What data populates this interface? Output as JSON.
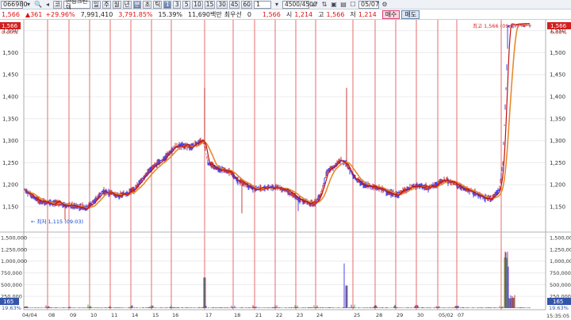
{
  "toolbar": {
    "code": "066980",
    "type_btn": "코",
    "name": "한성크린텍",
    "periods": [
      "일",
      "주",
      "월",
      "년",
      "분",
      "초",
      "틱"
    ],
    "selected_period": "분",
    "numbers": [
      "1",
      "3",
      "5",
      "10",
      "15",
      "30",
      "45",
      "60"
    ],
    "count": "1",
    "range": "4500/4500",
    "date": "05/07"
  },
  "quote": {
    "price": "1,566",
    "change": "361",
    "change_pct": "+29.96%",
    "volume": "7,991,410",
    "volume_pct": "3,791.85%",
    "turnover": "15.39%",
    "amount": "11,690백만",
    "preferred_label": "최우선",
    "preferred_value": "0",
    "price2": "1,566",
    "open_label": "시",
    "open": "1,214",
    "high_label": "고",
    "high": "1,566",
    "low_label": "저",
    "low": "1,214",
    "buy_label": "매수",
    "sell_label": "매도"
  },
  "chart_data": {
    "type": "line",
    "price_axis": [
      "1,566",
      "1,550",
      "1,500",
      "1,450",
      "1,400",
      "1,350",
      "1,300",
      "1,250",
      "1,200",
      "1,150"
    ],
    "volume_axis": [
      "1,500,000",
      "1,250,000",
      "1,000,000",
      "750,000",
      "500,000",
      "250,000"
    ],
    "dates": [
      "04/04",
      "08",
      "09",
      "10",
      "11",
      "14",
      "15",
      "16",
      "17",
      "18",
      "21",
      "22",
      "23",
      "24",
      "25",
      "28",
      "29",
      "30",
      "05/02",
      "07"
    ],
    "high_annotation": "최고 1,566 (09:27)",
    "low_annotation": "최저 1,115 (09:03)",
    "price_label_left": "1,566",
    "price_label_left_pct": "0.00%",
    "price_label_right": "1,566",
    "price_label_right_pct": "0.00%",
    "volume_label_left": "165",
    "volume_label_left_pct": "19.63%",
    "volume_label_right": "165",
    "volume_label_right_pct": "19.63%",
    "time": "15:35:05",
    "colors": {
      "candle": "#1a1ae6",
      "ma_short": "#c01010",
      "ma_long": "#e68a2e",
      "separator": "#e04848"
    }
  }
}
